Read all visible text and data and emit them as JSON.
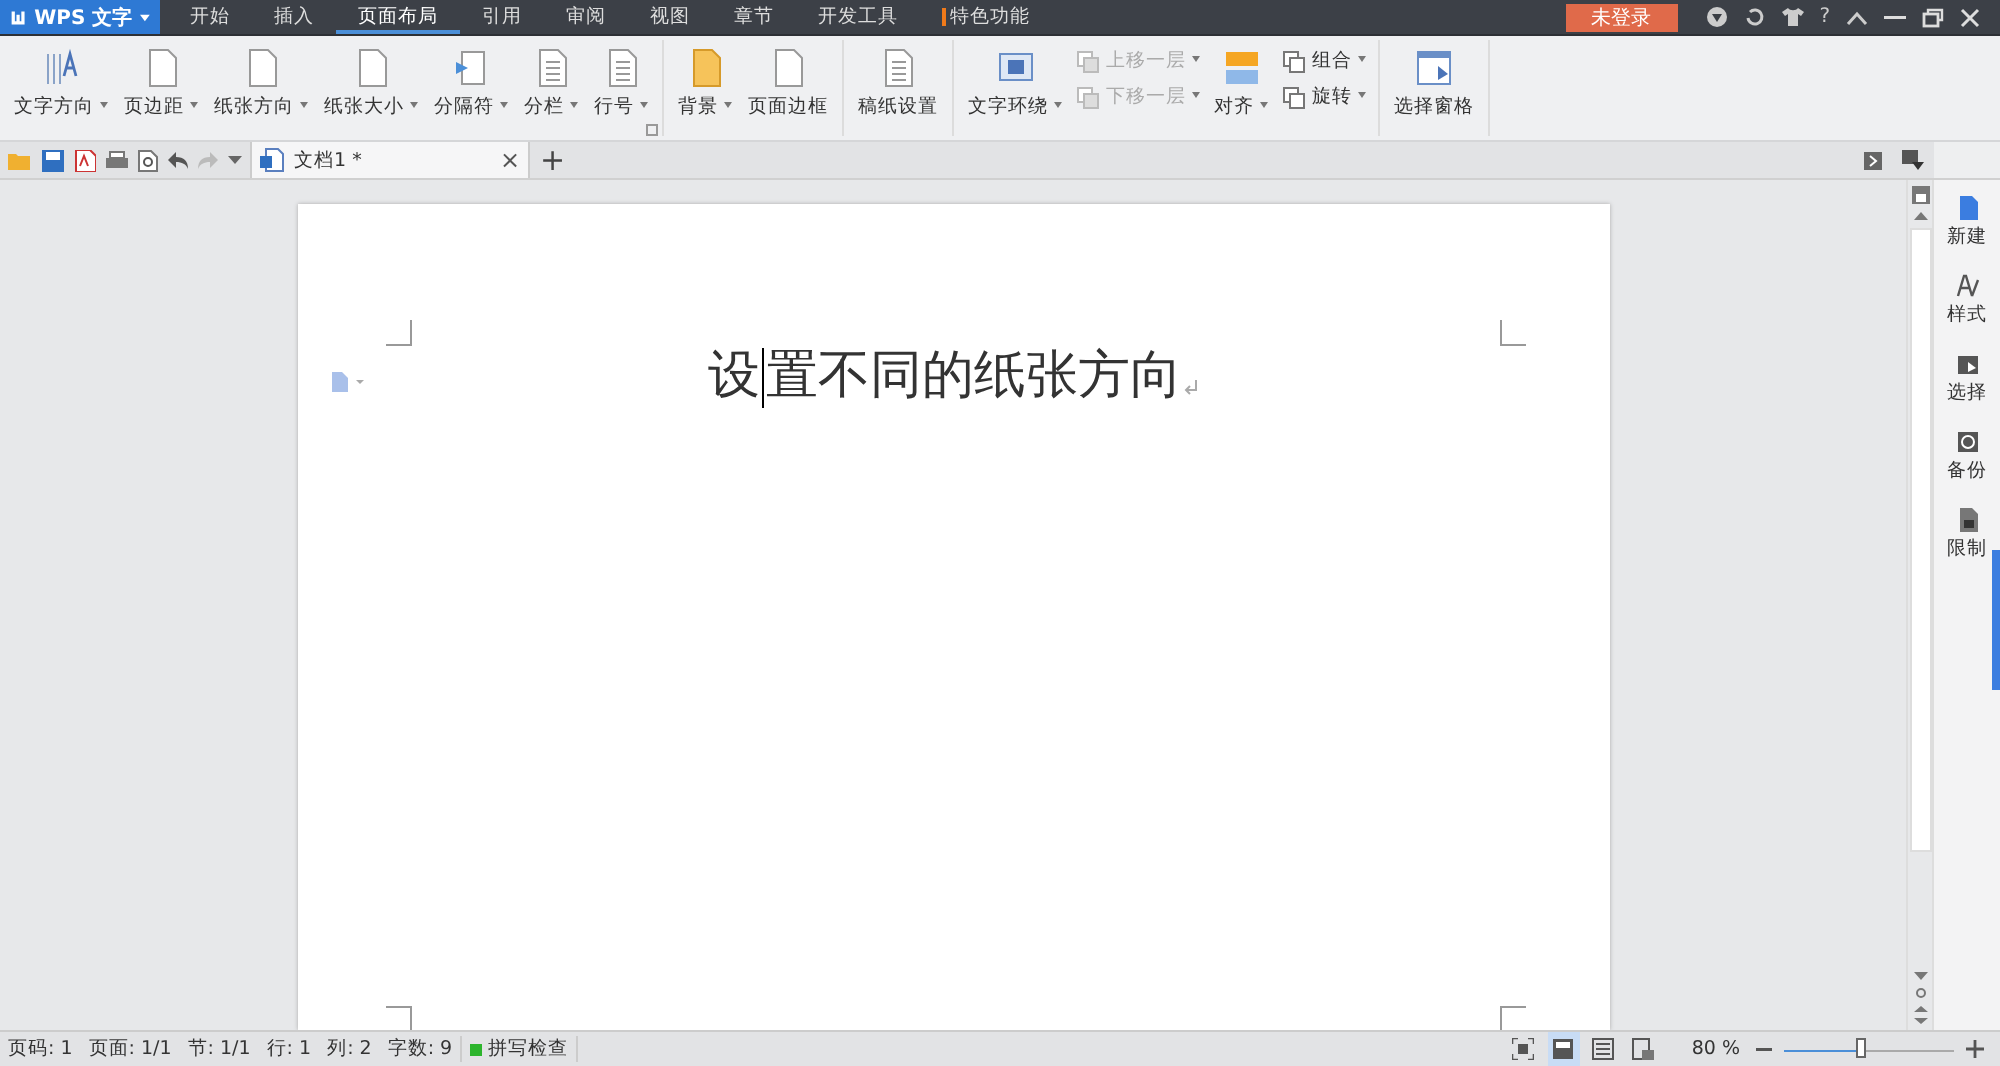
{
  "app_button": {
    "label": "WPS 文字"
  },
  "menu_tabs": [
    {
      "label": "开始",
      "selected": false,
      "kind": "plain"
    },
    {
      "label": "插入",
      "selected": false,
      "kind": "plain"
    },
    {
      "label": "页面布局",
      "selected": true,
      "kind": "plain"
    },
    {
      "label": "引用",
      "selected": false,
      "kind": "plain"
    },
    {
      "label": "审阅",
      "selected": false,
      "kind": "plain"
    },
    {
      "label": "视图",
      "selected": false,
      "kind": "plain"
    },
    {
      "label": "章节",
      "selected": false,
      "kind": "plain"
    },
    {
      "label": "开发工具",
      "selected": false,
      "kind": "plain"
    },
    {
      "label": "特色功能",
      "selected": false,
      "kind": "special"
    }
  ],
  "login_button": {
    "label": "未登录"
  },
  "help_button": {
    "label": "?"
  },
  "ribbon_groups": [
    {
      "items": [
        {
          "kind": "large",
          "label": "文字方向",
          "dropdown": true
        },
        {
          "kind": "large",
          "label": "页边距",
          "dropdown": true
        },
        {
          "kind": "large",
          "label": "纸张方向",
          "dropdown": true
        },
        {
          "kind": "large",
          "label": "纸张大小",
          "dropdown": true
        },
        {
          "kind": "large",
          "label": "分隔符",
          "dropdown": true
        },
        {
          "kind": "large",
          "label": "分栏",
          "dropdown": true
        },
        {
          "kind": "large",
          "label": "行号",
          "dropdown": true
        }
      ]
    },
    {
      "items": [
        {
          "kind": "large",
          "label": "背景",
          "dropdown": true
        },
        {
          "kind": "large",
          "label": "页面边框",
          "dropdown": false
        }
      ]
    },
    {
      "items": [
        {
          "kind": "large",
          "label": "稿纸设置",
          "dropdown": false
        }
      ]
    },
    {
      "items": [
        {
          "kind": "large",
          "label": "文字环绕",
          "dropdown": true
        },
        {
          "kind": "stack",
          "items": [
            {
              "label": "上移一层",
              "dropdown": true,
              "disabled": true
            },
            {
              "label": "下移一层",
              "dropdown": true,
              "disabled": true
            }
          ]
        },
        {
          "kind": "large",
          "label": "对齐",
          "dropdown": true
        },
        {
          "kind": "stack",
          "items": [
            {
              "label": "组合",
              "dropdown": true,
              "disabled": false
            },
            {
              "label": "旋转",
              "dropdown": true,
              "disabled": false
            }
          ]
        }
      ]
    },
    {
      "items": [
        {
          "kind": "large",
          "label": "选择窗格",
          "dropdown": false
        }
      ]
    }
  ],
  "doc_tab": {
    "title": "文档1 *",
    "close": "×"
  },
  "new_tab": {
    "label": "+"
  },
  "document": {
    "text_before_caret": "设",
    "text_after_caret": "置不同的纸张方向"
  },
  "task_pane": [
    {
      "label": "新建"
    },
    {
      "label": "样式"
    },
    {
      "label": "选择"
    },
    {
      "label": "备份"
    },
    {
      "label": "限制"
    }
  ],
  "status_bar": {
    "fields": [
      "页码: 1",
      "页面: 1/1",
      "节: 1/1",
      "行: 1",
      "列: 2",
      "字数: 9"
    ],
    "spell_check": {
      "label": "拼写检查",
      "on": true
    },
    "views": [
      {
        "selected": false
      },
      {
        "selected": true
      },
      {
        "selected": false
      },
      {
        "selected": false
      }
    ],
    "zoom": "80 %",
    "zoom_slider": {
      "level": 0.46
    }
  }
}
